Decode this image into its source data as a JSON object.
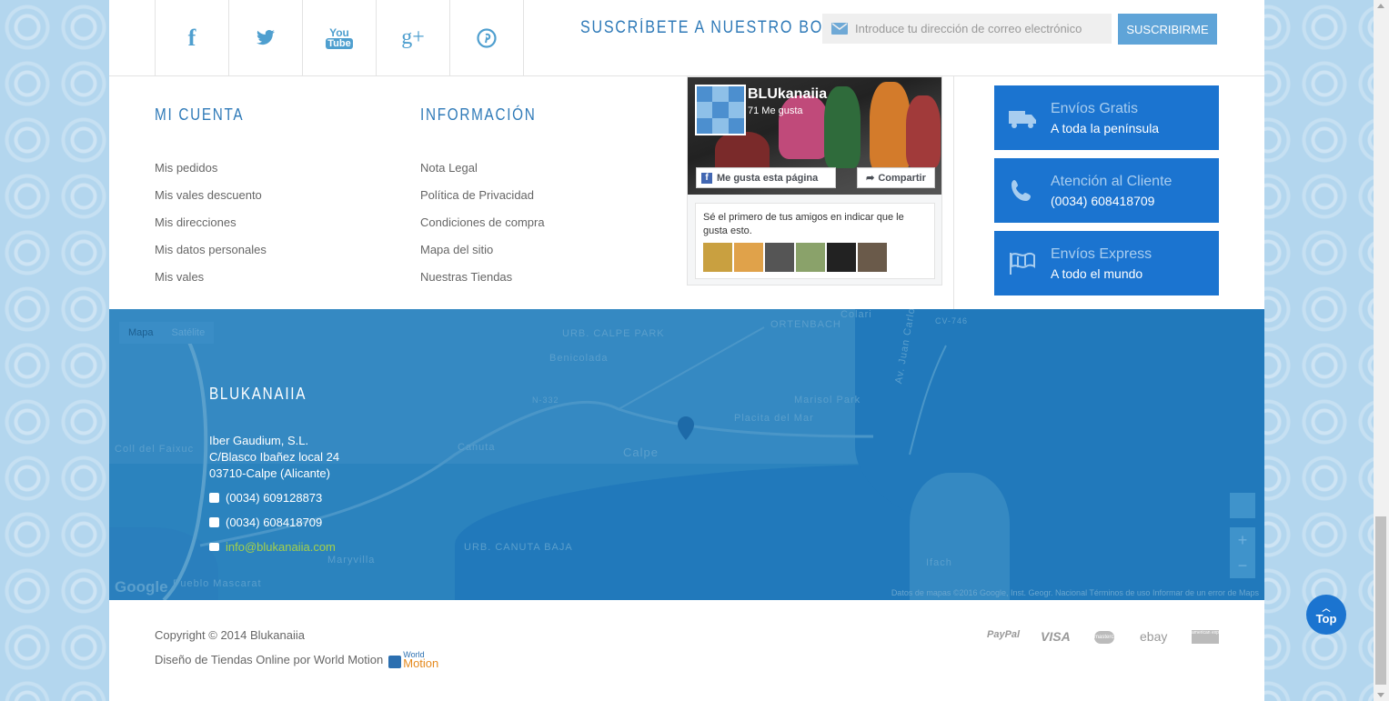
{
  "social": {
    "icons": [
      "facebook-icon",
      "twitter-icon",
      "youtube-icon",
      "google-plus-icon",
      "pinterest-icon"
    ],
    "youtube_text_top": "You",
    "youtube_text_bottom": "Tube",
    "google_plus_text": "g+"
  },
  "newsletter": {
    "title": "SUSCRÍBETE A NUESTRO BOLETÍN",
    "placeholder": "Introduce tu dirección de correo electrónico",
    "button": "SUSCRIBIRME"
  },
  "account": {
    "title": "MI CUENTA",
    "links": [
      "Mis pedidos",
      "Mis vales descuento",
      "Mis direcciones",
      "Mis datos personales",
      "Mis vales"
    ]
  },
  "info": {
    "title": "INFORMACIÓN",
    "links": [
      "Nota Legal",
      "Política de Privacidad",
      "Condiciones de compra",
      "Mapa del sitio",
      "Nuestras Tiendas"
    ]
  },
  "facebook": {
    "page_name": "BLUkanaiia",
    "likes": "71 Me gusta",
    "like_button": "Me gusta esta página",
    "share_button": "Compartir",
    "friends_text": "Sé el primero de tus amigos en indicar que le gusta esto."
  },
  "services": [
    {
      "title": "Envíos Gratis",
      "subtitle": "A toda la península",
      "icon": "truck-icon"
    },
    {
      "title": "Atención al Cliente",
      "subtitle": "(0034) 608418709",
      "icon": "phone-icon"
    },
    {
      "title": "Envíos Express",
      "subtitle": "A todo el mundo",
      "icon": "flag-icon"
    }
  ],
  "map": {
    "tabs": [
      "Mapa",
      "Satélite"
    ],
    "labels": [
      "URB. CALPE PARK",
      "Benicolada",
      "ORTENBACH",
      "Colari",
      "Marisol Park",
      "Placita del Mar",
      "Calpe",
      "Canuta",
      "Coll del Faixuc",
      "Maryvilla",
      "Pueblo Mascarat",
      "URB. CANUTA BAJA",
      "Ifach",
      "Av. Juan Carlos I",
      "N-332",
      "CV-746"
    ],
    "footer": "Datos de mapas ©2016 Google, Inst. Geogr. Nacional   Términos de uso   Informar de un error de Maps",
    "google": "Google"
  },
  "store": {
    "name": "BLUKANAIIA",
    "company": "Iber Gaudium, S.L.",
    "street": "C/Blasco Ibañez local 24",
    "city": "03710-Calpe (Alicante)",
    "phone1": "(0034) 609128873",
    "phone2": "(0034) 608418709",
    "email": "info@blukanaiia.com"
  },
  "footer": {
    "copyright": "Copyright © 2014 Blukanaiia",
    "design": "Diseño de Tiendas Online por World Motion",
    "wm_top": "World",
    "wm_bottom": "Motion",
    "payments": [
      "PayPal",
      "VISA",
      "mastercard",
      "ebay",
      "american express"
    ]
  },
  "top_button": "Top"
}
